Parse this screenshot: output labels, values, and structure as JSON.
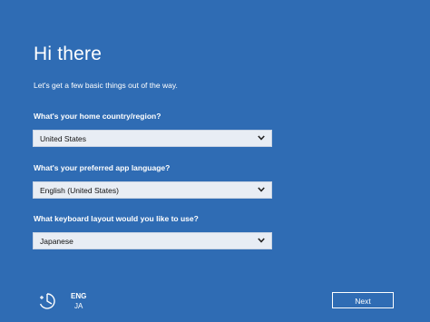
{
  "title": "Hi there",
  "subtitle": "Let's get a few basic things out of the way.",
  "fields": [
    {
      "label": "What's your home country/region?",
      "value": "United States"
    },
    {
      "label": "What's your preferred app language?",
      "value": "English (United States)"
    },
    {
      "label": "What keyboard layout would you like to use?",
      "value": "Japanese"
    }
  ],
  "language": {
    "primary": "ENG",
    "secondary": "JA"
  },
  "next_label": "Next",
  "icons": {
    "accessibility": "ease-of-access-icon",
    "dropdown": "chevron-down-icon"
  },
  "colors": {
    "background": "#2f6cb4",
    "dropdown_bg": "#e8edf4",
    "text": "#ffffff"
  }
}
